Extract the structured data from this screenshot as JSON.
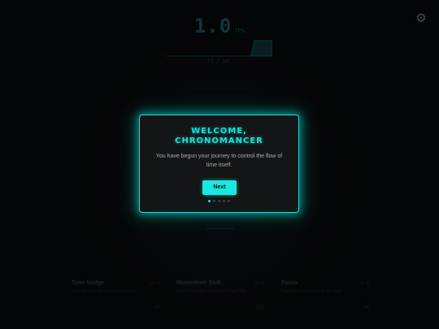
{
  "header": {
    "tps_value": "1.0",
    "tps_unit": "TPS",
    "graph_label": "t1 / sec"
  },
  "settings": {
    "icon": "gear-icon"
  },
  "upgrades": [
    {
      "title": "Time Nudge",
      "level": "Lv 0",
      "description": "Increase your base time flow by 0.1",
      "cost": "10"
    },
    {
      "title": "Momentum Shift",
      "level": "Lv 0",
      "description": "Gain momentum over time, boost TPS",
      "cost": "100"
    },
    {
      "title": "Focus",
      "level": "Lv 0",
      "description": "Channel focus to amplify the flow",
      "cost": "1K"
    }
  ],
  "modal": {
    "title_line1": "WELCOME,",
    "title_line2": "CHRONOMANCER",
    "body": "You have begun your journey to control the flow of time itself.",
    "next_label": "Next",
    "step_total": 5,
    "step_current": 1
  },
  "colors": {
    "accent": "#19e3da",
    "background": "#060708",
    "modal_bg": "#131517"
  }
}
